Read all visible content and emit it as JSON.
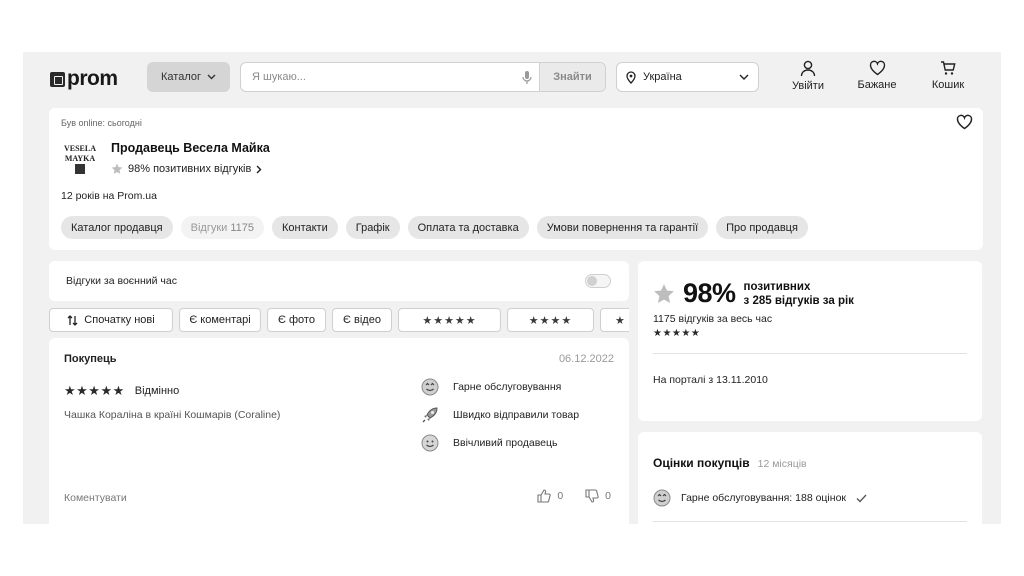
{
  "header": {
    "logo_text": "prom",
    "catalog_label": "Каталог",
    "search_placeholder": "Я шукаю...",
    "search_button": "Знайти",
    "region": "Україна",
    "login_label": "Увійти",
    "wishlist_label": "Бажане",
    "cart_label": "Кошик"
  },
  "seller": {
    "online_status": "Був online: сьогодні",
    "name": "Продавець Весела Майка",
    "positive_rating": "98% позитивних відгуків",
    "years": "12 років на Prom.ua",
    "logo_text": "VESELA MAYKA",
    "tabs": [
      {
        "label": "Каталог продавця"
      },
      {
        "label": "Відгуки",
        "count": "1175"
      },
      {
        "label": "Контакти"
      },
      {
        "label": "Графік"
      },
      {
        "label": "Оплата та доставка"
      },
      {
        "label": "Умови повернення та гарантії"
      },
      {
        "label": "Про продавця"
      }
    ]
  },
  "reviews": {
    "wartime_label": "Відгуки за воєнний час",
    "wartime_toggle_on": false,
    "filters": {
      "sort": "Спочатку нові",
      "with_comments": "Є коментарі",
      "with_photo": "Є фото",
      "with_video": "Є відео",
      "stars5": "★★★★★",
      "stars4": "★★★★",
      "stars3": "★"
    },
    "item": {
      "buyer": "Покупець",
      "date": "06.12.2022",
      "stars": "★★★★★",
      "rating_text": "Відмінно",
      "product": "Чашка Кораліна в країні Кошмарів (Coraline)",
      "tags": [
        "Гарне обслуговування",
        "Швидко відправили товар",
        "Ввічливий продавець"
      ],
      "comment_label": "Коментувати",
      "likes": "0",
      "dislikes": "0"
    }
  },
  "summary": {
    "percent": "98%",
    "line1": "позитивних",
    "line2": "з 285 відгуків за рік",
    "all_time": "1175 відгуків за весь час",
    "stars": "★★★★★",
    "since": "На порталі з 13.11.2010"
  },
  "purchase_ratings": {
    "title": "Оцінки покупців",
    "period": "12 місяців",
    "first_row": "Гарне обслуговування: 188 оцінок"
  }
}
